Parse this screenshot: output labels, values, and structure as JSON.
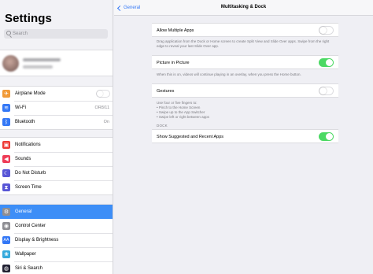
{
  "sidebar": {
    "title": "Settings",
    "search_placeholder": "Search",
    "group1": [
      {
        "label": "Airplane Mode",
        "icon": "airplane-icon",
        "color": "#f19a37",
        "glyph": "✈",
        "toggle": false
      },
      {
        "label": "Wi-Fi",
        "icon": "wifi-icon",
        "color": "#3478f6",
        "glyph": "≋",
        "value": "OR8/11"
      },
      {
        "label": "Bluetooth",
        "icon": "bluetooth-icon",
        "color": "#3478f6",
        "glyph": "ᛒ",
        "value": "On"
      }
    ],
    "group2": [
      {
        "label": "Notifications",
        "icon": "notifications-icon",
        "color": "#ee3b36",
        "glyph": "▣"
      },
      {
        "label": "Sounds",
        "icon": "sounds-icon",
        "color": "#ee3b56",
        "glyph": "◀"
      },
      {
        "label": "Do Not Disturb",
        "icon": "moon-icon",
        "color": "#5856d6",
        "glyph": "☾"
      },
      {
        "label": "Screen Time",
        "icon": "hourglass-icon",
        "color": "#5856d6",
        "glyph": "⧗"
      }
    ],
    "group3": [
      {
        "label": "General",
        "icon": "gear-icon",
        "color": "#8e8e93",
        "glyph": "⚙",
        "selected": true
      },
      {
        "label": "Control Center",
        "icon": "control-center-icon",
        "color": "#8e8e93",
        "glyph": "◉"
      },
      {
        "label": "Display & Brightness",
        "icon": "display-icon",
        "color": "#3478f6",
        "glyph": "AA"
      },
      {
        "label": "Wallpaper",
        "icon": "wallpaper-icon",
        "color": "#36aadc",
        "glyph": "❀"
      },
      {
        "label": "Siri & Search",
        "icon": "siri-icon",
        "color": "#222233",
        "glyph": "◍"
      }
    ]
  },
  "detail": {
    "back_label": "General",
    "title": "Multitasking & Dock",
    "allow_multiple_apps": {
      "label": "Allow Multiple Apps",
      "on": false,
      "footer": "Drag application from the Dock or Home screen to create Split View and Slide Over apps. Swipe from the right edge to reveal your last Slide Over app."
    },
    "picture_in_picture": {
      "label": "Picture in Picture",
      "on": true,
      "footer": "When this is on, videos will continue playing in an overlay, when you press the Home button."
    },
    "gestures": {
      "label": "Gestures",
      "on": false,
      "footer_lines": [
        "Use four or five fingers to:",
        "• Pinch to the Home Screen",
        "• Swipe up to the App Switcher",
        "• Swipe left or right between apps"
      ]
    },
    "dock_header": "DOCK",
    "show_suggested": {
      "label": "Show Suggested and Recent Apps",
      "on": true
    }
  },
  "colors": {
    "accent": "#3478f6",
    "selected_row": "#3d8ef7",
    "toggle_on": "#4cd964"
  }
}
